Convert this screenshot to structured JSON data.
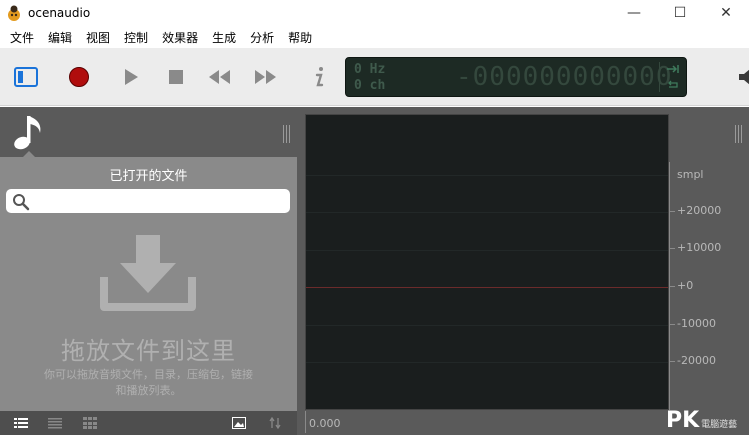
{
  "window": {
    "title": "ocenaudio",
    "minimize_glyph": "—",
    "maximize_glyph": "☐",
    "close_glyph": "✕"
  },
  "menu": [
    "文件",
    "编辑",
    "视图",
    "控制",
    "效果器",
    "生成",
    "分析",
    "帮助"
  ],
  "toolbar": {
    "icons": [
      "panel-toggle-icon",
      "record-icon",
      "play-icon",
      "stop-icon",
      "rewind-icon",
      "fast-forward-icon",
      "info-icon"
    ],
    "accent": "#1a73d9",
    "record_color": "#b00d0d"
  },
  "lcd": {
    "frequency": "0 Hz",
    "channels": "0 ch",
    "time": "-000000000000"
  },
  "files_panel": {
    "title": "已打开的文件",
    "search_placeholder": "",
    "drop_title": "拖放文件到这里",
    "drop_hint": "你可以拖放音频文件，目录，压缩包，链接和播放列表。"
  },
  "scale": {
    "unit": "smpl",
    "labels": [
      "+20000",
      "+10000",
      "+0",
      "-10000",
      "-20000"
    ]
  },
  "timeline": {
    "start": "0.000"
  },
  "watermark": {
    "brand": "PK",
    "sub": "電腦遊藝"
  }
}
